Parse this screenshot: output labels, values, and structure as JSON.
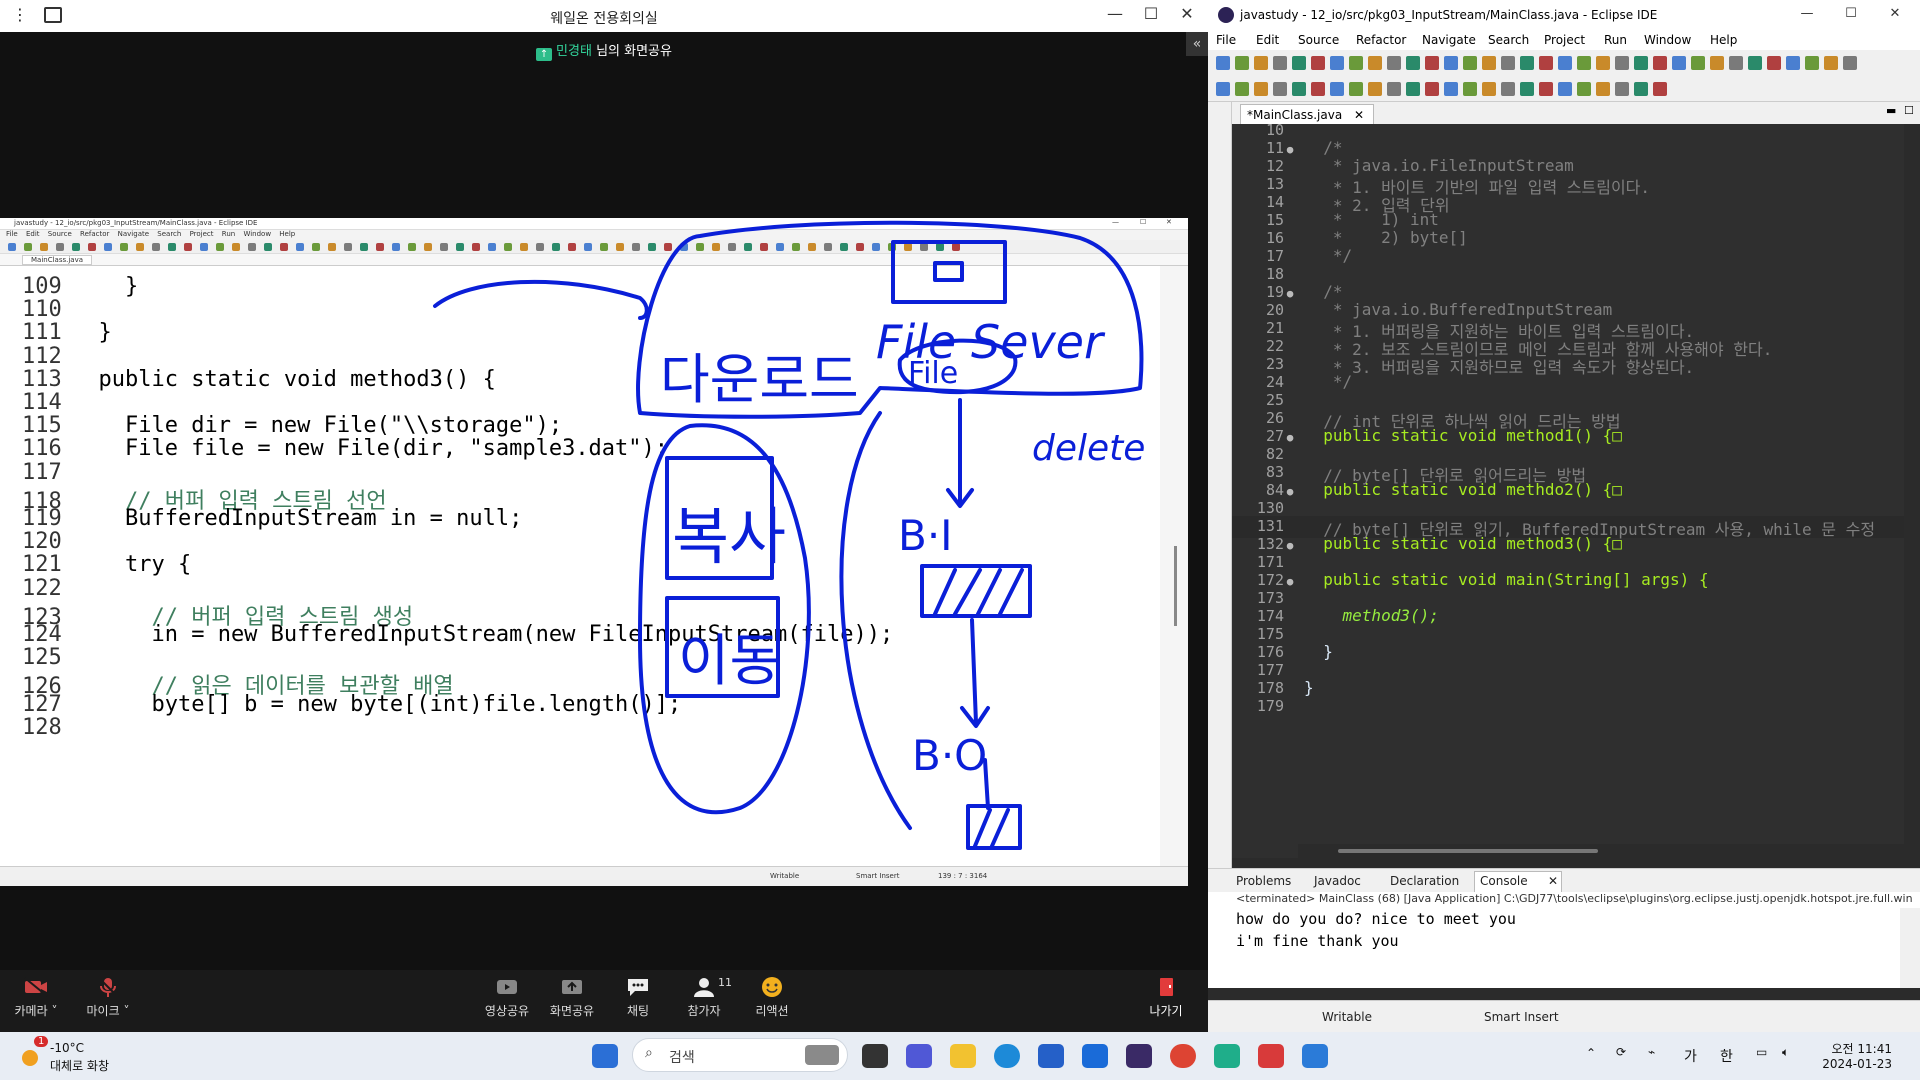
{
  "zoom": {
    "title": "웨일온 전용회의실",
    "share_banner": {
      "name": "민경태",
      "text": "님의 화면공유"
    },
    "toolbar": {
      "camera": "카메라",
      "mic": "마이크",
      "video_share": "영상공유",
      "screen_share": "화면공유",
      "chat": "채팅",
      "participants": "참가자",
      "participants_count": "11",
      "reaction": "리액션",
      "leave": "나가기"
    }
  },
  "shared_screen": {
    "title": "javastudy - 12_io/src/pkg03_InputStream/MainClass.java - Eclipse IDE",
    "menu": [
      "File",
      "Edit",
      "Source",
      "Refactor",
      "Navigate",
      "Search",
      "Project",
      "Run",
      "Window",
      "Help"
    ],
    "tab": "MainClass.java",
    "status": {
      "writable": "Writable",
      "insert": "Smart Insert",
      "position": "139 : 7 : 3164"
    },
    "code_lines": [
      {
        "n": "109",
        "t": "    }"
      },
      {
        "n": "110",
        "t": ""
      },
      {
        "n": "111",
        "t": "  }"
      },
      {
        "n": "112",
        "t": ""
      },
      {
        "n": "113",
        "t": "  public static void method3() {"
      },
      {
        "n": "114",
        "t": ""
      },
      {
        "n": "115",
        "t": "    File dir = new File(\"\\\\storage\");"
      },
      {
        "n": "116",
        "t": "    File file = new File(dir, \"sample3.dat\");"
      },
      {
        "n": "117",
        "t": ""
      },
      {
        "n": "118",
        "t": "    // 버퍼 입력 스트림 선언"
      },
      {
        "n": "119",
        "t": "    BufferedInputStream in = null;"
      },
      {
        "n": "120",
        "t": ""
      },
      {
        "n": "121",
        "t": "    try {"
      },
      {
        "n": "122",
        "t": ""
      },
      {
        "n": "123",
        "t": "      // 버퍼 입력 스트림 생성"
      },
      {
        "n": "124",
        "t": "      in = new BufferedInputStream(new FileInputStream(file));"
      },
      {
        "n": "125",
        "t": ""
      },
      {
        "n": "126",
        "t": "      // 읽은 데이터를 보관할 배열"
      },
      {
        "n": "127",
        "t": "      byte[] b = new byte[(int)file.length()];"
      },
      {
        "n": "128",
        "t": ""
      }
    ],
    "annotations": {
      "download": "다운로드",
      "file_server": "File Sever",
      "file": "File",
      "delete": "delete",
      "copy": "복사",
      "move": "이동",
      "bi": "B·I",
      "bo": "B·O"
    }
  },
  "eclipse": {
    "title": "javastudy - 12_io/src/pkg03_InputStream/MainClass.java - Eclipse IDE",
    "menu": [
      "File",
      "Edit",
      "Source",
      "Refactor",
      "Navigate",
      "Search",
      "Project",
      "Run",
      "Window",
      "Help"
    ],
    "editor_tab": "*MainClass.java",
    "lines": [
      {
        "n": "10",
        "m": "",
        "t": ""
      },
      {
        "n": "11",
        "m": "●",
        "t": "  /*"
      },
      {
        "n": "12",
        "m": "",
        "t": "   * java.io.FileInputStream"
      },
      {
        "n": "13",
        "m": "",
        "t": "   * 1. 바이트 기반의 파일 입력 스트림이다."
      },
      {
        "n": "14",
        "m": "",
        "t": "   * 2. 입력 단위"
      },
      {
        "n": "15",
        "m": "",
        "t": "   *    1) int"
      },
      {
        "n": "16",
        "m": "",
        "t": "   *    2) byte[]"
      },
      {
        "n": "17",
        "m": "",
        "t": "   */"
      },
      {
        "n": "18",
        "m": "",
        "t": ""
      },
      {
        "n": "19",
        "m": "●",
        "t": "  /*"
      },
      {
        "n": "20",
        "m": "",
        "t": "   * java.io.BufferedInputStream"
      },
      {
        "n": "21",
        "m": "",
        "t": "   * 1. 버퍼링을 지원하는 바이트 입력 스트림이다."
      },
      {
        "n": "22",
        "m": "",
        "t": "   * 2. 보조 스트림이므로 메인 스트림과 함께 사용해야 한다."
      },
      {
        "n": "23",
        "m": "",
        "t": "   * 3. 버퍼링을 지원하므로 입력 속도가 향상된다."
      },
      {
        "n": "24",
        "m": "",
        "t": "   */"
      },
      {
        "n": "25",
        "m": "",
        "t": ""
      },
      {
        "n": "26",
        "m": "",
        "t": "  // int 단위로 하나씩 읽어 드리는 방법"
      },
      {
        "n": "27",
        "m": "●",
        "t": "  public static void method1() {□"
      },
      {
        "n": "82",
        "m": "",
        "t": ""
      },
      {
        "n": "83",
        "m": "",
        "t": "  // byte[] 단위로 읽어드리는 방법"
      },
      {
        "n": "84",
        "m": "●",
        "t": "  public static void methdo2() {□"
      },
      {
        "n": "130",
        "m": "",
        "t": ""
      },
      {
        "n": "131",
        "m": "",
        "t": "  // byte[] 단위로 읽기, BufferedInputStream 사용, while 문 수정"
      },
      {
        "n": "132",
        "m": "●",
        "t": "  public static void method3() {□"
      },
      {
        "n": "171",
        "m": "",
        "t": ""
      },
      {
        "n": "172",
        "m": "●",
        "t": "  public static void main(String[] args) {"
      },
      {
        "n": "173",
        "m": "",
        "t": ""
      },
      {
        "n": "174",
        "m": "",
        "t": "    method3();"
      },
      {
        "n": "175",
        "m": "",
        "t": ""
      },
      {
        "n": "176",
        "m": "",
        "t": "  }"
      },
      {
        "n": "177",
        "m": "",
        "t": ""
      },
      {
        "n": "178",
        "m": "",
        "t": "}"
      },
      {
        "n": "179",
        "m": "",
        "t": ""
      }
    ],
    "console_tabs": [
      "Problems",
      "Javadoc",
      "Declaration",
      "Console"
    ],
    "console_desc": "<terminated> MainClass (68) [Java Application] C:\\GDJ77\\tools\\eclipse\\plugins\\org.eclipse.justj.openjdk.hotspot.jre.full.win",
    "console_output": [
      "how do you do? nice to meet you",
      "i'm fine thank you"
    ],
    "status": {
      "writable": "Writable",
      "insert": "Smart Insert"
    }
  },
  "taskbar": {
    "weather_temp": "-10°C",
    "weather_desc": "대체로 화창",
    "weather_badge": "1",
    "search_placeholder": "검색",
    "ime_lang": "가",
    "ime_mode": "한",
    "time": "오전 11:41",
    "date": "2024-01-23"
  },
  "colors": {
    "ink": "#0a1fd8",
    "zoom_green": "#32d49b",
    "leave_red": "#e23b3b"
  }
}
